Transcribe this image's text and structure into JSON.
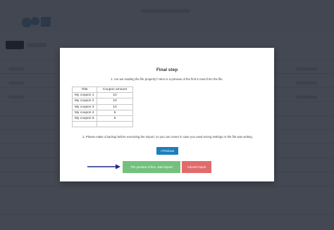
{
  "modal": {
    "title": "Final step",
    "step1_text": "1. Are we reading the file properly? Here is a preview of the first 5 rows from the file.",
    "table": {
      "headers": [
        "Title",
        "Coupon amount"
      ],
      "rows": [
        [
          "My coupon 1",
          "10"
        ],
        [
          "My coupon 2",
          "10"
        ],
        [
          "My coupon 3",
          "10"
        ],
        [
          "My coupon 4",
          "5"
        ],
        [
          "My coupon 5",
          "5"
        ],
        [
          "",
          ""
        ]
      ]
    },
    "step2_text": "2. Please make a backup before executing the import, so you can revert in case you used wrong settings or the file was writing.",
    "previous_label": "Previous",
    "start_label": "The preview is fine, start import",
    "cancel_label": "Cancel import"
  },
  "colors": {
    "overlay": "#181d28",
    "primary": "#1b7fbd",
    "success": "#74c17e",
    "danger": "#e16b6b",
    "arrow": "#1f2a8a"
  },
  "icons": {
    "previous": "chevron-left-icon",
    "annotation": "arrow-right-icon"
  }
}
